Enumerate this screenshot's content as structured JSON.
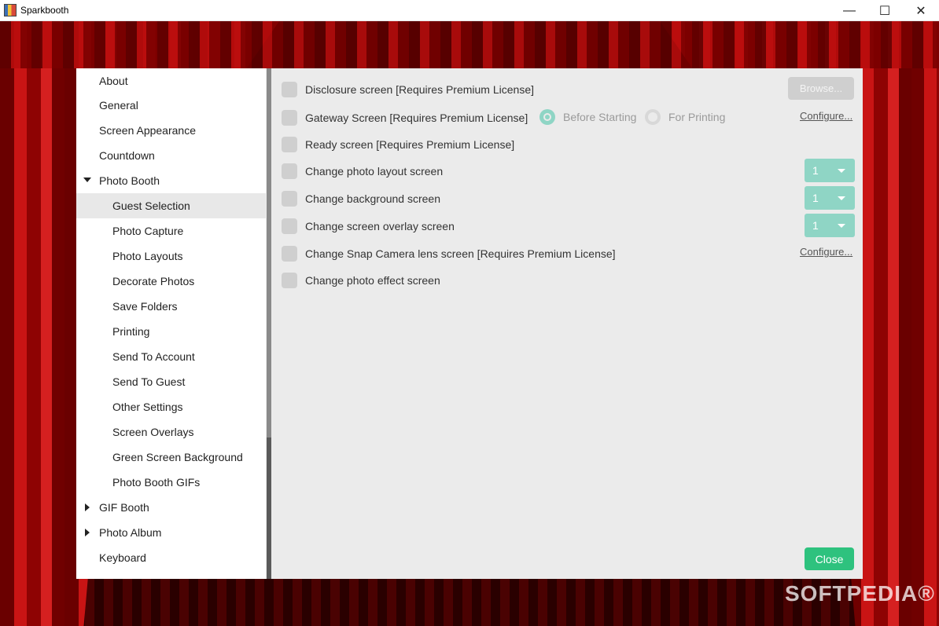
{
  "window": {
    "title": "Sparkbooth",
    "minimize": "—",
    "maximize": "☐",
    "close": "✕"
  },
  "sidebar": {
    "items": [
      {
        "label": "About"
      },
      {
        "label": "General"
      },
      {
        "label": "Screen Appearance"
      },
      {
        "label": "Countdown"
      },
      {
        "label": "Photo Booth"
      },
      {
        "label": "Guest Selection"
      },
      {
        "label": "Photo Capture"
      },
      {
        "label": "Photo Layouts"
      },
      {
        "label": "Decorate Photos"
      },
      {
        "label": "Save Folders"
      },
      {
        "label": "Printing"
      },
      {
        "label": "Send To Account"
      },
      {
        "label": "Send To Guest"
      },
      {
        "label": "Other Settings"
      },
      {
        "label": "Screen Overlays"
      },
      {
        "label": "Green Screen Background"
      },
      {
        "label": "Photo Booth GIFs"
      },
      {
        "label": "GIF Booth"
      },
      {
        "label": "Photo Album"
      },
      {
        "label": "Keyboard"
      }
    ]
  },
  "main": {
    "rows": [
      {
        "label": "Disclosure screen [Requires Premium License]"
      },
      {
        "label": "Gateway Screen [Requires Premium License]"
      },
      {
        "label": "Ready screen [Requires Premium License]"
      },
      {
        "label": "Change photo layout screen"
      },
      {
        "label": "Change background screen"
      },
      {
        "label": "Change screen overlay screen"
      },
      {
        "label": "Change Snap Camera lens screen [Requires Premium License]"
      },
      {
        "label": "Change photo effect screen"
      }
    ],
    "browse_label": "Browse...",
    "radio_before": "Before Starting",
    "radio_for_printing": "For Printing",
    "configure_label": "Configure...",
    "dropdowns": {
      "layout": "1",
      "background": "1",
      "overlay": "1"
    },
    "close_label": "Close"
  },
  "watermark": "SOFTPEDIA®",
  "colors": {
    "accent": "#8fd5c5",
    "close_button": "#2ec27e",
    "checkbox": "#cfcfcf"
  }
}
